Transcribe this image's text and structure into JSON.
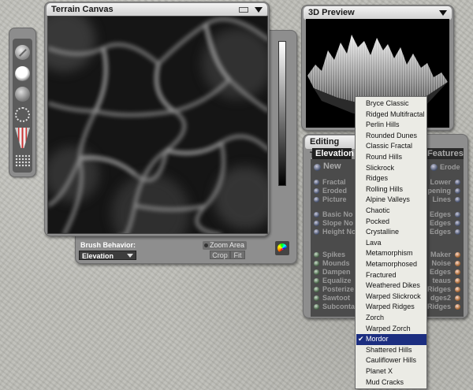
{
  "terrain_canvas": {
    "title": "Terrain Canvas"
  },
  "brush": {
    "behavior_label": "Brush Behavior:",
    "behavior_value": "Elevation",
    "zoom_area_label": "Zoom Area",
    "crop_label": "Crop",
    "fit_label": "Fit"
  },
  "preview": {
    "title": "3D Preview"
  },
  "editing_tools": {
    "title": "Editing Tools",
    "active_tab": "Elevation",
    "features_tab": "Features",
    "new_label": "New",
    "erode_label": "Erode",
    "left_column": [
      {
        "label": "Fractal"
      },
      {
        "label": "Eroded"
      },
      {
        "label": "Picture"
      },
      {
        "label": "Basic No"
      },
      {
        "label": "Slope No"
      },
      {
        "label": "Height No"
      },
      {
        "label": "Spikes"
      },
      {
        "label": "Mounds"
      },
      {
        "label": "Dampen"
      },
      {
        "label": "Equalize"
      },
      {
        "label": "Posterize"
      },
      {
        "label": "Sawtoot"
      },
      {
        "label": "Subconta"
      }
    ],
    "right_column": [
      {
        "label": "Lower"
      },
      {
        "label": "pening"
      },
      {
        "label": "Lines"
      },
      {
        "label": "Edges"
      },
      {
        "label": "Edges"
      },
      {
        "label": "Edges"
      },
      {
        "label": "Maker"
      },
      {
        "label": "Noise"
      },
      {
        "label": "Edges"
      },
      {
        "label": "teaus"
      },
      {
        "label": "Ridges"
      },
      {
        "label": "dges2"
      },
      {
        "label": "Ridges"
      }
    ]
  },
  "fractal_menu": {
    "selected": "Mordor",
    "items": [
      "Bryce Classic",
      "Ridged Multifractal",
      "Perlin Hills",
      "Rounded Dunes",
      "Classic Fractal",
      "Round Hills",
      "Slickrock",
      "Ridges",
      "Rolling Hills",
      "Alpine Valleys",
      "Chaotic",
      "Pocked",
      "Crystalline",
      "Lava",
      "Metamorphism",
      "Metamorphosed",
      "Fractured",
      "Weathered Dikes",
      "Warped Slickrock",
      "Warped Ridges",
      "Zorch",
      "Warped Zorch",
      "Mordor",
      "Shattered Hills",
      "Cauliflower Hills",
      "Planet X",
      "Mud Cracks"
    ]
  },
  "icons": {
    "tools": [
      "brush-tool-icon",
      "soft-brush-icon",
      "sphere-brush-icon",
      "dotted-brush-icon",
      "gradient-brush-icon",
      "grid-icon"
    ],
    "rainbow": "color-map-icon"
  }
}
